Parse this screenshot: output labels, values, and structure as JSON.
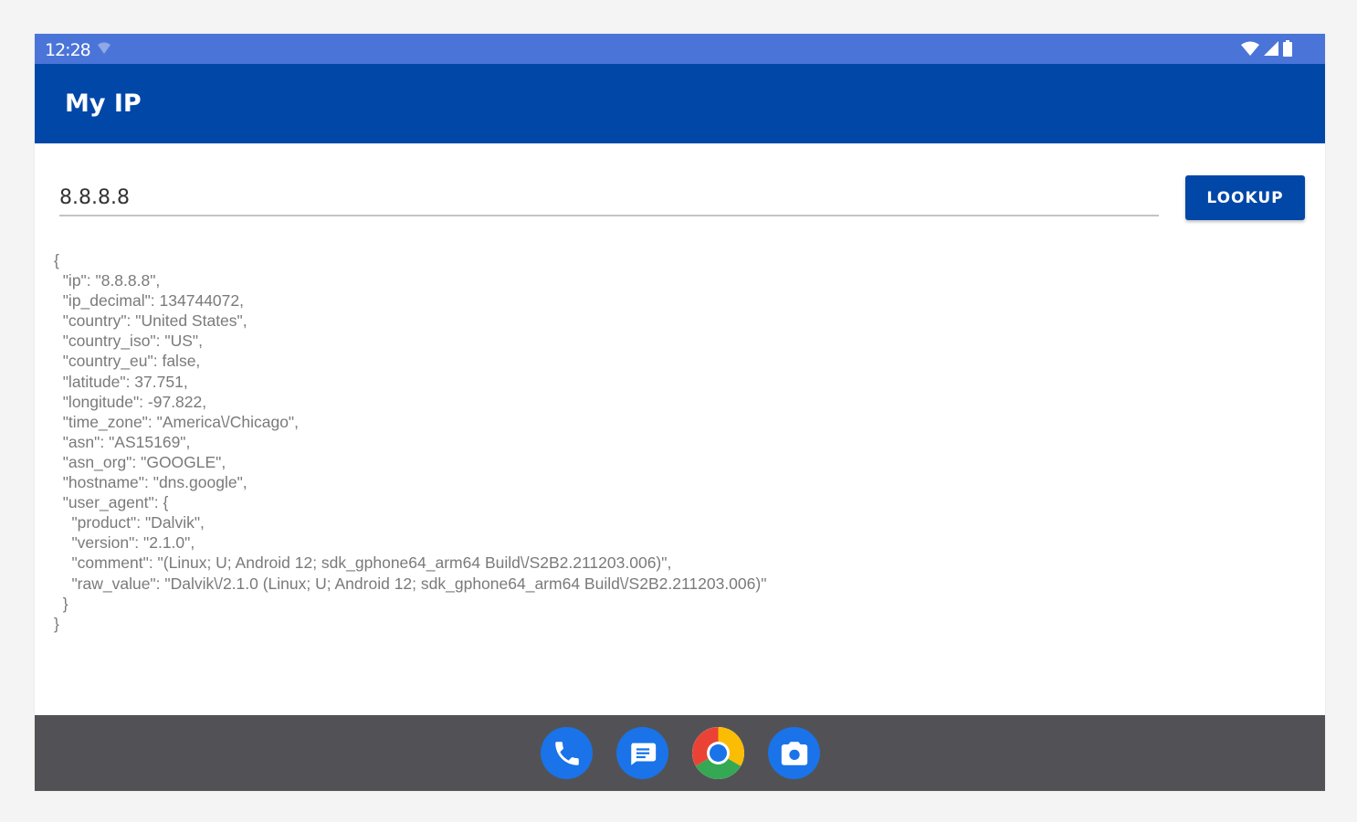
{
  "status_bar": {
    "time": "12:28"
  },
  "app_bar": {
    "title": "My IP"
  },
  "lookup": {
    "input_value": "8.8.8.8",
    "button_label": "LOOKUP"
  },
  "result": {
    "json_lines": [
      "{",
      "  \"ip\": \"8.8.8.8\",",
      "  \"ip_decimal\": 134744072,",
      "  \"country\": \"United States\",",
      "  \"country_iso\": \"US\",",
      "  \"country_eu\": false,",
      "  \"latitude\": 37.751,",
      "  \"longitude\": -97.822,",
      "  \"time_zone\": \"America\\/Chicago\",",
      "  \"asn\": \"AS15169\",",
      "  \"asn_org\": \"GOOGLE\",",
      "  \"hostname\": \"dns.google\",",
      "  \"user_agent\": {",
      "    \"product\": \"Dalvik\",",
      "    \"version\": \"2.1.0\",",
      "    \"comment\": \"(Linux; U; Android 12; sdk_gphone64_arm64 Build\\/S2B2.211203.006)\",",
      "    \"raw_value\": \"Dalvik\\/2.1.0 (Linux; U; Android 12; sdk_gphone64_arm64 Build\\/S2B2.211203.006)\"",
      "  }",
      "}"
    ]
  },
  "dock": {
    "apps": [
      "phone-icon",
      "messages-icon",
      "chrome-icon",
      "camera-icon"
    ]
  },
  "colors": {
    "status_bar": "#4a74d8",
    "app_bar": "#0047a8",
    "button": "#0047a8",
    "nav_bar": "#525256",
    "json_text": "#7a7a7a"
  }
}
